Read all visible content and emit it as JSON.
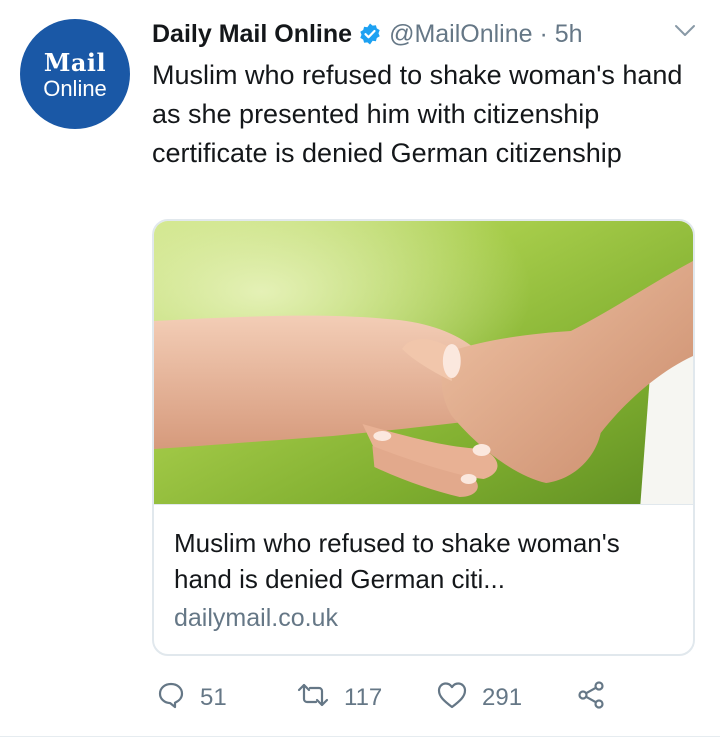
{
  "avatar": {
    "line1": "Mail",
    "line2": "Online"
  },
  "tweet": {
    "name": "Daily Mail Online",
    "handle": "@MailOnline · 5h",
    "text": "Muslim who refused to shake woman's hand as she presented him with citizenship certificate is denied German citizenship"
  },
  "card": {
    "title": "Muslim who refused to shake woman's hand is denied German citi...",
    "domain": "dailymail.co.uk"
  },
  "actions": {
    "replies": "51",
    "retweets": "117",
    "likes": "291"
  },
  "colors": {
    "brand_blue": "#1a58a6",
    "verified_blue": "#1da1f2",
    "muted": "#657786"
  }
}
